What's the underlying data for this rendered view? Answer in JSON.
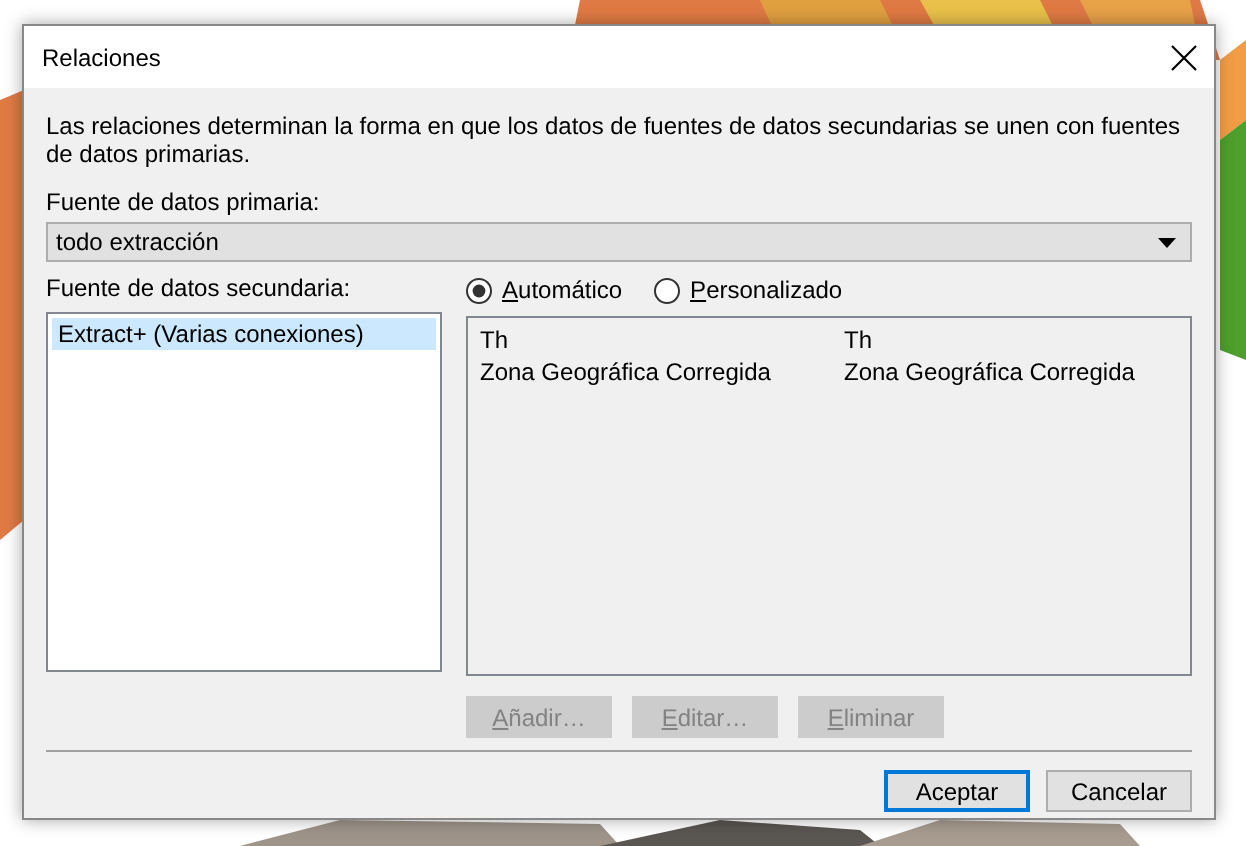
{
  "window": {
    "title": "Relaciones"
  },
  "description": "Las relaciones determinan la forma en que los datos de fuentes de datos secundarias se unen con fuentes de datos primarias.",
  "primary_source": {
    "label": "Fuente de datos primaria:",
    "value": "todo extracción"
  },
  "secondary_source": {
    "label": "Fuente de datos secundaria:",
    "items": [
      {
        "label": "Extract+ (Varias conexiones)",
        "selected": true
      }
    ]
  },
  "mode": [
    {
      "label": "Automático",
      "selected": true
    },
    {
      "label": "Personalizado",
      "selected": false
    }
  ],
  "mappings": [
    {
      "column_1": "Th",
      "column_2": "Th"
    },
    {
      "column_1": "Zona Geográfica Corregida",
      "column_2": "Zona Geográfica Corregida"
    }
  ],
  "mapping_buttons": [
    {
      "label": "Añadir…",
      "disabled": true
    },
    {
      "label": "Editar…",
      "disabled": true
    },
    {
      "label": "Eliminar",
      "disabled": true
    }
  ],
  "buttons": [
    {
      "label": "Aceptar",
      "default": true
    },
    {
      "label": "Cancelar",
      "default": false
    }
  ]
}
